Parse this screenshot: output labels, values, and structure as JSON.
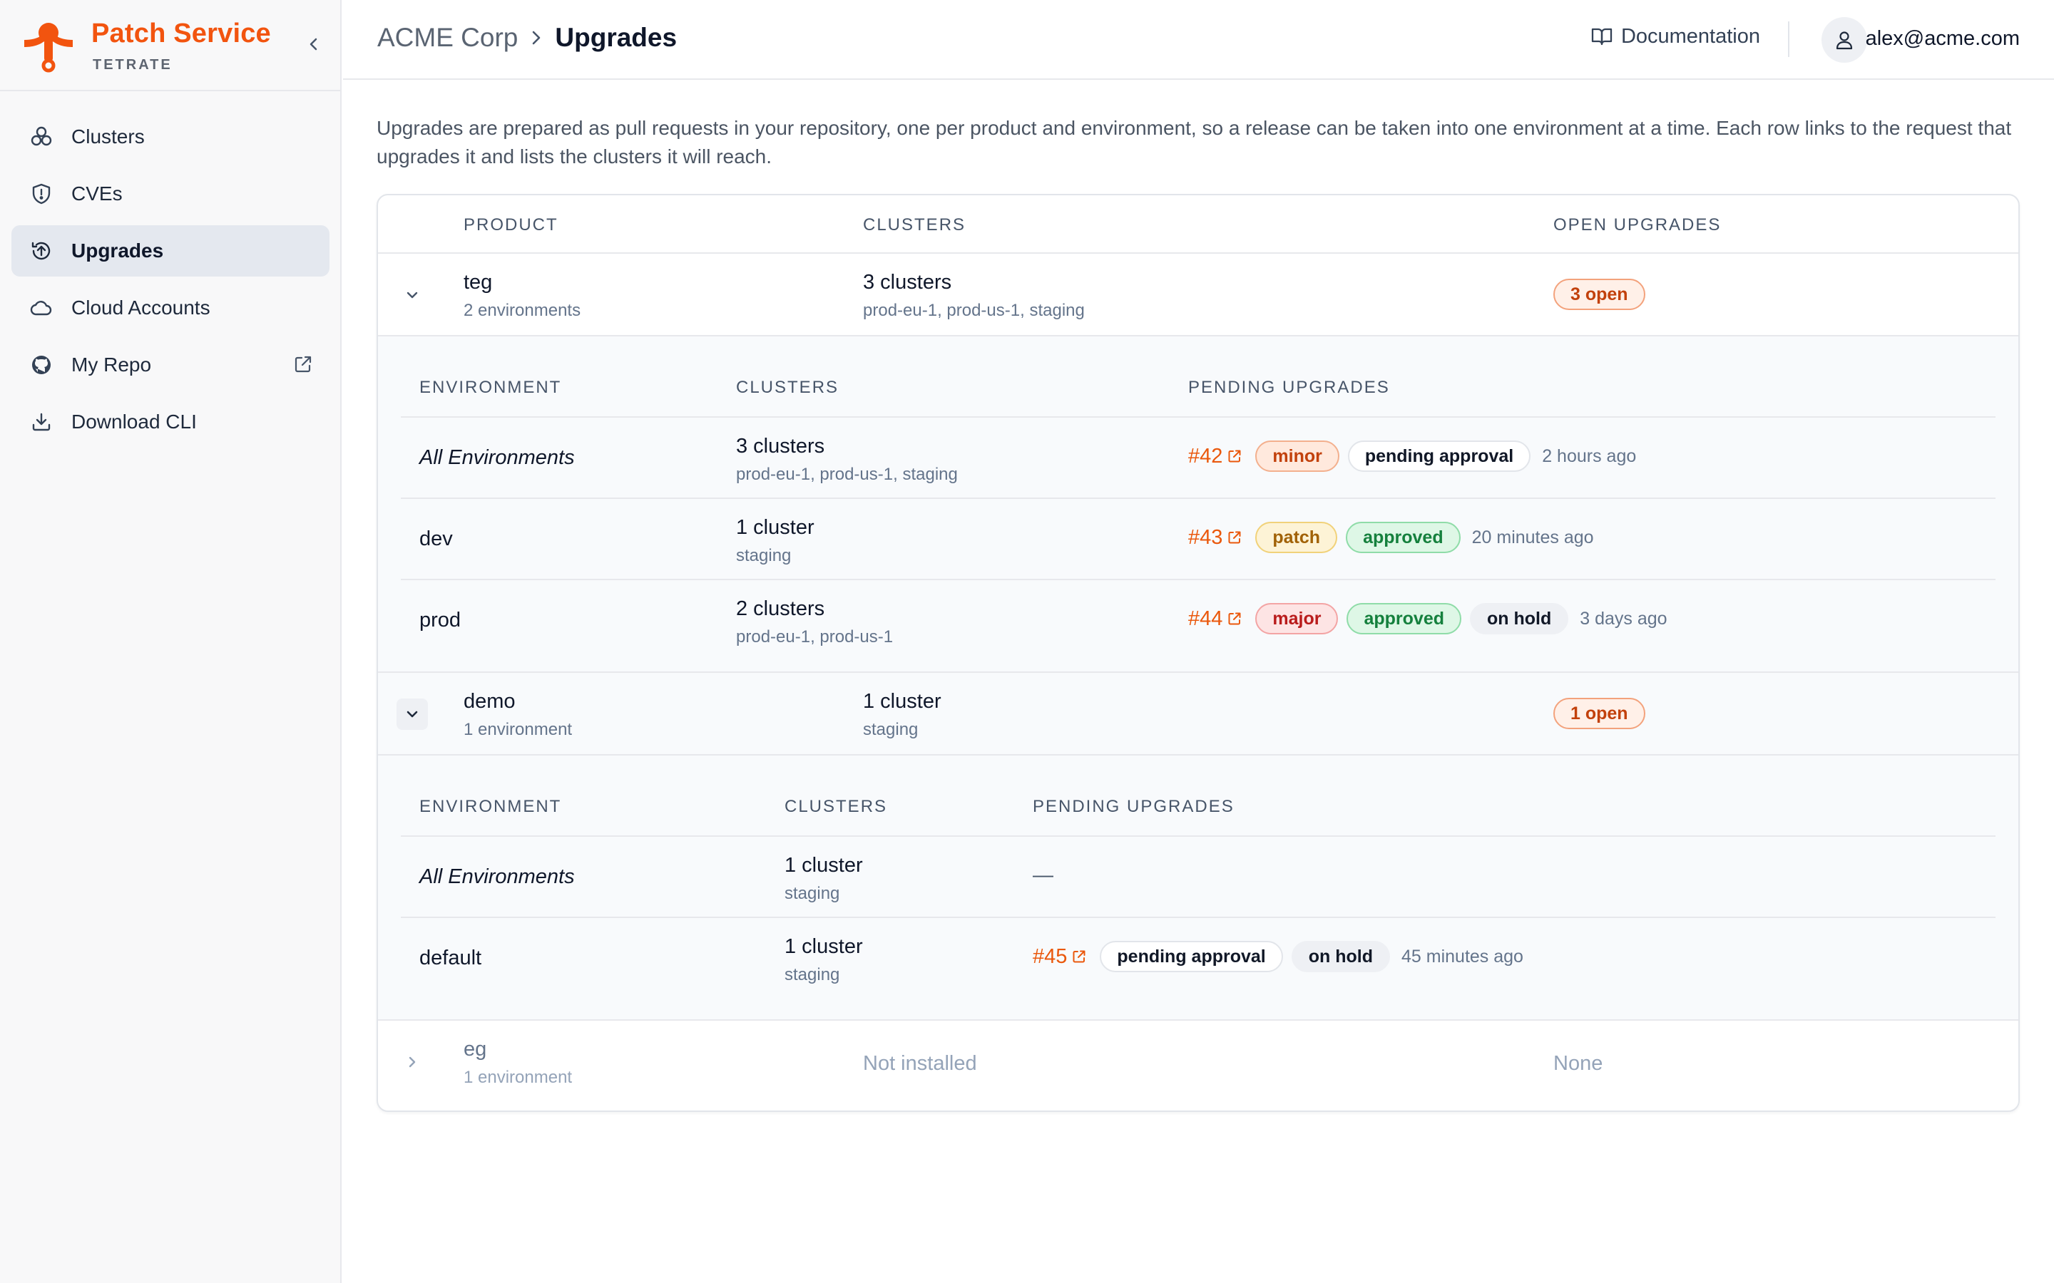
{
  "brand": {
    "name": "Patch Service",
    "sub": "TETRATE",
    "accent": "#f2540f"
  },
  "sidebar": {
    "items": [
      {
        "label": "Clusters",
        "icon": "clusters-icon"
      },
      {
        "label": "CVEs",
        "icon": "shield-icon"
      },
      {
        "label": "Upgrades",
        "icon": "upgrade-icon",
        "active": true
      },
      {
        "label": "Cloud Accounts",
        "icon": "cloud-icon"
      },
      {
        "label": "My Repo",
        "icon": "github-icon",
        "external": true
      },
      {
        "label": "Download CLI",
        "icon": "download-icon"
      }
    ]
  },
  "header": {
    "org": "ACME Corp",
    "page": "Upgrades",
    "docs": "Documentation",
    "user": "alex@acme.com"
  },
  "intro": "Upgrades are prepared as pull requests in your repository, one per product and environment, so a release can be taken into one environment at a time. Each row links to the request that upgrades it and lists the clusters it will reach.",
  "table": {
    "headers": {
      "product": "PRODUCT",
      "clusters": "CLUSTERS",
      "open": "OPEN UPGRADES"
    },
    "inner_headers": {
      "env": "ENVIRONMENT",
      "clusters": "CLUSTERS",
      "pending": "PENDING UPGRADES"
    },
    "products": [
      {
        "name": "teg",
        "envs": "2 environments",
        "clusters": "3 clusters",
        "cluster_list": "prod-eu-1, prod-us-1, staging",
        "open": "3 open",
        "rows": [
          {
            "env": "All Environments",
            "clusters": "3 clusters",
            "cluster_list": "prod-eu-1, prod-us-1, staging",
            "pr": "#42",
            "tags": [
              "minor",
              "pending approval"
            ],
            "ago": "2 hours ago"
          },
          {
            "env": "dev",
            "clusters": "1 cluster",
            "cluster_list": "staging",
            "pr": "#43",
            "tags": [
              "patch",
              "approved"
            ],
            "ago": "20 minutes ago"
          },
          {
            "env": "prod",
            "clusters": "2 clusters",
            "cluster_list": "prod-eu-1, prod-us-1",
            "pr": "#44",
            "tags": [
              "major",
              "approved",
              "on hold"
            ],
            "ago": "3 days ago"
          }
        ]
      },
      {
        "name": "demo",
        "envs": "1 environment",
        "clusters": "1 cluster",
        "cluster_list": "staging",
        "open": "1 open",
        "rows": [
          {
            "env": "All Environments",
            "clusters": "1 cluster",
            "cluster_list": "staging",
            "none": "—"
          },
          {
            "env": "default",
            "clusters": "1 cluster",
            "cluster_list": "staging",
            "pr": "#45",
            "tags": [
              "pending approval",
              "on hold"
            ],
            "ago": "45 minutes ago"
          }
        ]
      },
      {
        "name": "eg",
        "envs": "1 environment",
        "clusters": "Not installed",
        "open": "None"
      }
    ]
  }
}
